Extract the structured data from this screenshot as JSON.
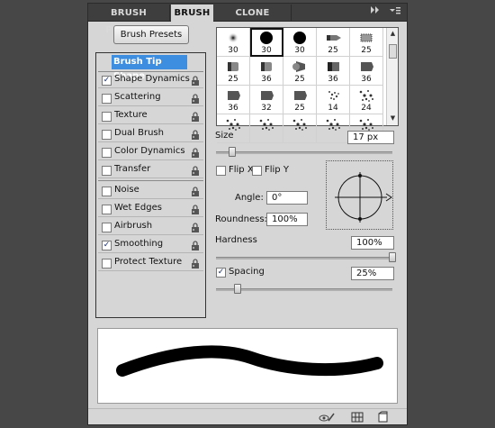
{
  "tabs": [
    {
      "label": "BRUSH PRESETS",
      "active": false
    },
    {
      "label": "BRUSH",
      "active": true
    },
    {
      "label": "CLONE SOURCE",
      "active": false
    }
  ],
  "tab_controls": {
    "collapse_icon": "double-chevron-right-icon",
    "menu_icon": "panel-menu-icon"
  },
  "brush_presets_button": "Brush Presets",
  "sidebar": {
    "title": "Brush Tip Shape",
    "items": [
      {
        "label": "Shape Dynamics",
        "checked": true
      },
      {
        "label": "Scattering",
        "checked": false
      },
      {
        "label": "Texture",
        "checked": false
      },
      {
        "label": "Dual Brush",
        "checked": false
      },
      {
        "label": "Color Dynamics",
        "checked": false
      },
      {
        "label": "Transfer",
        "checked": false
      },
      {
        "label": "Noise",
        "checked": false
      },
      {
        "label": "Wet Edges",
        "checked": false
      },
      {
        "label": "Airbrush",
        "checked": false
      },
      {
        "label": "Smoothing",
        "checked": true
      },
      {
        "label": "Protect Texture",
        "checked": false
      }
    ]
  },
  "brush_tips": [
    {
      "size": "30",
      "shape": "soft-round",
      "selected": false
    },
    {
      "size": "30",
      "shape": "hard-round",
      "selected": true
    },
    {
      "size": "30",
      "shape": "hard-round",
      "selected": false
    },
    {
      "size": "25",
      "shape": "pencil",
      "selected": false
    },
    {
      "size": "25",
      "shape": "chalk",
      "selected": false
    },
    {
      "size": "25",
      "shape": "brush-side",
      "selected": false
    },
    {
      "size": "36",
      "shape": "brush-side",
      "selected": false
    },
    {
      "size": "25",
      "shape": "fan",
      "selected": false
    },
    {
      "size": "36",
      "shape": "marker",
      "selected": false
    },
    {
      "size": "36",
      "shape": "flat",
      "selected": false
    },
    {
      "size": "36",
      "shape": "flat",
      "selected": false
    },
    {
      "size": "32",
      "shape": "flat",
      "selected": false
    },
    {
      "size": "25",
      "shape": "flat",
      "selected": false
    },
    {
      "size": "14",
      "shape": "bristle",
      "selected": false
    },
    {
      "size": "24",
      "shape": "spatter",
      "selected": false
    },
    {
      "size": "",
      "shape": "spatter",
      "selected": false
    },
    {
      "size": "",
      "shape": "spatter",
      "selected": false
    },
    {
      "size": "",
      "shape": "spatter",
      "selected": false
    },
    {
      "size": "",
      "shape": "spatter",
      "selected": false
    },
    {
      "size": "",
      "shape": "spatter",
      "selected": false
    }
  ],
  "size": {
    "label": "Size",
    "value": "17 px",
    "slider_fraction": 0.09
  },
  "flip_x": {
    "label": "Flip X",
    "checked": false
  },
  "flip_y": {
    "label": "Flip Y",
    "checked": false
  },
  "angle": {
    "label": "Angle:",
    "value": "0°"
  },
  "roundness": {
    "label": "Roundness:",
    "value": "100%"
  },
  "hardness": {
    "label": "Hardness",
    "value": "100%",
    "slider_fraction": 1.0
  },
  "spacing": {
    "label": "Spacing",
    "value": "25%",
    "checked": true,
    "slider_fraction": 0.12
  },
  "footer_icons": [
    "eye-brush-icon",
    "grid-icon",
    "new-preset-icon"
  ],
  "colors": {
    "panel_bg": "#d6d6d6",
    "tab_bar": "#3e3e3e",
    "selection": "#3d8ee0",
    "app_bg": "#474747"
  }
}
